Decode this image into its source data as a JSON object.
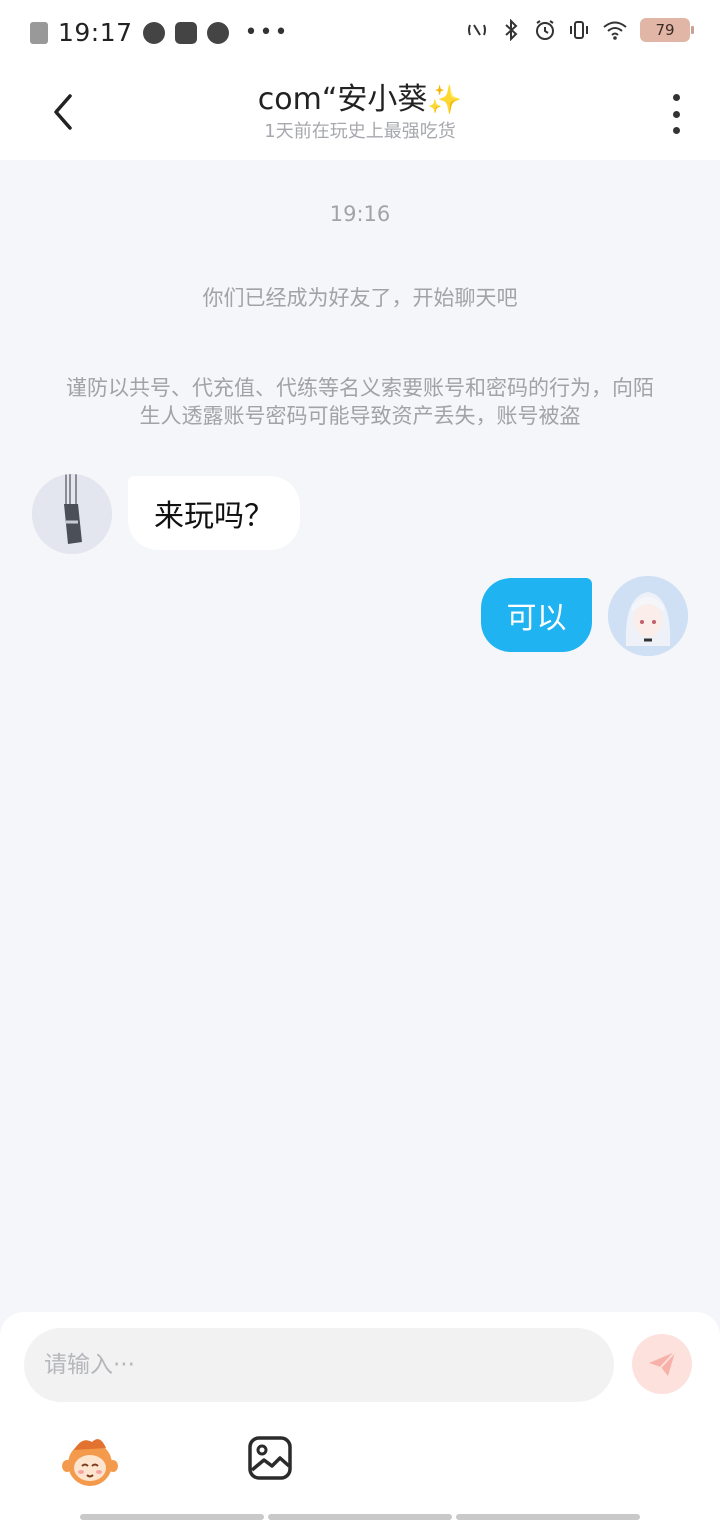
{
  "status_bar": {
    "time": "19:17",
    "battery": "79",
    "left_icons": [
      "sim-off-icon",
      "moon-icon",
      "card-icon",
      "voice-icon"
    ],
    "more": "•••",
    "right_icons": [
      "nfc-icon",
      "bluetooth-icon",
      "alarm-icon",
      "vibrate-icon",
      "wifi-icon",
      "battery-icon"
    ]
  },
  "header": {
    "title": "com“安小葵",
    "title_emoji": "✨",
    "subtitle": "1天前在玩史上最强吃货",
    "back_icon": "back-arrow-icon",
    "more_icon": "more-vertical-icon"
  },
  "chat": {
    "timestamp": "19:16",
    "system_message": "你们已经成为好友了，开始聊天吧",
    "warning": "谨防以共号、代充值、代练等名义索要账号和密码的行为，向陌生人透露账号密码可能导致资产丢失，账号被盗",
    "messages": [
      {
        "side": "left",
        "text": "来玩吗？"
      },
      {
        "side": "right",
        "text": "可以"
      }
    ]
  },
  "input": {
    "placeholder": "请输入···",
    "value": ""
  },
  "toolbar": {
    "send_icon": "send-paper-plane-icon",
    "emoji_icon": "emoji-sticker-icon",
    "image_icon": "image-picker-icon"
  },
  "colors": {
    "accent": "#20b3f2",
    "background": "#f4f6f9",
    "send_disabled": "#fde1dc"
  }
}
